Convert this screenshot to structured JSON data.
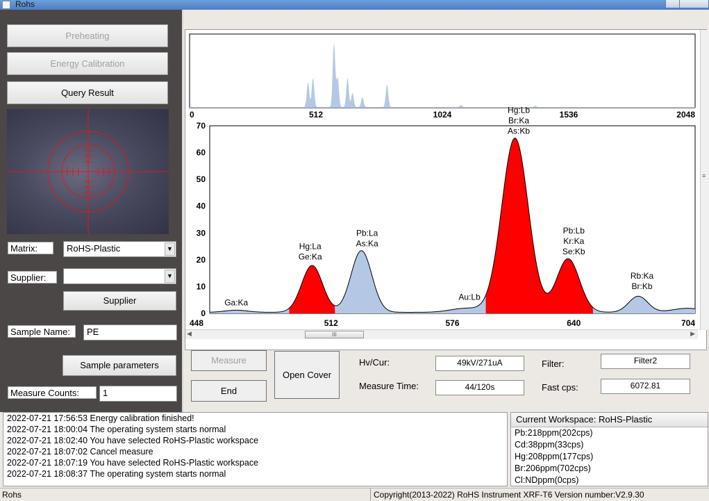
{
  "window": {
    "title": "Rohs"
  },
  "left": {
    "preheat_label": "Preheating",
    "energy_cal_label": "Energy Calibration",
    "query_label": "Query Result",
    "matrix_label": "Matrix:",
    "matrix_value": "RoHS-Plastic",
    "supplier_label": "Supplier:",
    "supplier_value": "",
    "supplier_button": "Supplier",
    "sample_name_label": "Sample Name:",
    "sample_name_value": "PE",
    "sample_params_label": "Sample parameters",
    "measure_counts_label": "Measure Counts:",
    "measure_counts_value": "1"
  },
  "controls": {
    "measure_label": "Measure",
    "end_label": "End",
    "open_cover_label": "Open Cover",
    "hv_label": "Hv/Cur:",
    "hv_value": "49kV/271uA",
    "measure_time_label": "Measure Time:",
    "measure_time_value": "44/120s",
    "filter_label": "Filter:",
    "filter_value": "Filter2",
    "fastcps_label": "Fast cps:",
    "fastcps_value": "6072.81"
  },
  "log": [
    "2022-07-21 17:56:53 Energy calibration finished!",
    "2022-07-21 18:00:04 The operating system starts normal",
    "2022-07-21 18:02:40 You have selected RoHS-Plastic workspace",
    "2022-07-21 18:07:02 Cancel measure",
    "2022-07-21 18:07:19 You have selected RoHS-Plastic workspace",
    "2022-07-21 18:08:37 The operating system starts normal"
  ],
  "workspace": {
    "header": "Current Workspace: RoHS-Plastic",
    "items": [
      "Pb:218ppm(202cps)",
      "Cd:38ppm(33cps)",
      "Hg:208ppm(177cps)",
      "Br:206ppm(702cps)",
      "Cl:NDppm(0cps)"
    ]
  },
  "status": {
    "left": "Rohs",
    "right": "Copyright(2013-2022) RoHS Instrument XRF-T6 Version number:V2.9.30"
  },
  "colors": {
    "peak_red": "#ff0000",
    "peak_blue": "#b4c8e6",
    "crosshair": "#e01818"
  },
  "chart_data": [
    {
      "type": "area",
      "name": "overview-spectrum",
      "xlim": [
        0,
        2048
      ],
      "x_ticks": [
        "0",
        "512",
        "1024",
        "1536",
        "2048"
      ],
      "peaks": [
        {
          "x": 480,
          "y": 0.38
        },
        {
          "x": 500,
          "y": 0.45
        },
        {
          "x": 585,
          "y": 1.0
        },
        {
          "x": 600,
          "y": 0.45
        },
        {
          "x": 640,
          "y": 0.45
        },
        {
          "x": 660,
          "y": 0.22
        },
        {
          "x": 700,
          "y": 0.15
        },
        {
          "x": 800,
          "y": 0.35
        },
        {
          "x": 1100,
          "y": 0.03
        },
        {
          "x": 1400,
          "y": 0.02
        }
      ]
    },
    {
      "type": "area",
      "name": "zoom-spectrum",
      "xlim": [
        448,
        704
      ],
      "ylim": [
        0,
        70
      ],
      "x_ticks": [
        "448",
        "512",
        "576",
        "640",
        "704"
      ],
      "y_ticks": [
        "0",
        "10",
        "20",
        "30",
        "40",
        "50",
        "60",
        "70"
      ],
      "peaks": [
        {
          "center": 462,
          "height": 0.8,
          "width": 6,
          "fill": "blue",
          "labels": [
            "Ga:Ka"
          ],
          "label_x": 462,
          "label_y": 2
        },
        {
          "center": 502,
          "height": 17.5,
          "width": 5.5,
          "fill": "red",
          "labels": [
            "Hg:La",
            "Ge:Ka"
          ],
          "label_x": 501,
          "label_y": 19
        },
        {
          "center": 528,
          "height": 23,
          "width": 5.5,
          "fill": "blue",
          "labels": [
            "Pb:La",
            "As:Ka"
          ],
          "label_x": 531,
          "label_y": 24
        },
        {
          "center": 583,
          "height": 1.5,
          "width": 8,
          "fill": "blue",
          "labels": [
            "Au:Lb"
          ],
          "label_x": 585,
          "label_y": 4
        },
        {
          "center": 609,
          "height": 65,
          "width": 7,
          "fill": "red",
          "labels": [
            "Hg:Lb",
            "Br:Ka",
            "As:Kb"
          ],
          "label_x": 611,
          "label_y": 66
        },
        {
          "center": 637,
          "height": 20,
          "width": 6,
          "fill": "red",
          "labels": [
            "Pb:Lb",
            "Kr:Ka",
            "Se:Kb"
          ],
          "label_x": 640,
          "label_y": 21
        },
        {
          "center": 674,
          "height": 6,
          "width": 5,
          "fill": "blue",
          "labels": [
            "Rb:Ka",
            "Br:Kb"
          ],
          "label_x": 676,
          "label_y": 8
        },
        {
          "center": 700,
          "height": 1.5,
          "width": 8,
          "fill": "blue",
          "labels": [],
          "label_x": 700,
          "label_y": 0
        }
      ]
    }
  ]
}
